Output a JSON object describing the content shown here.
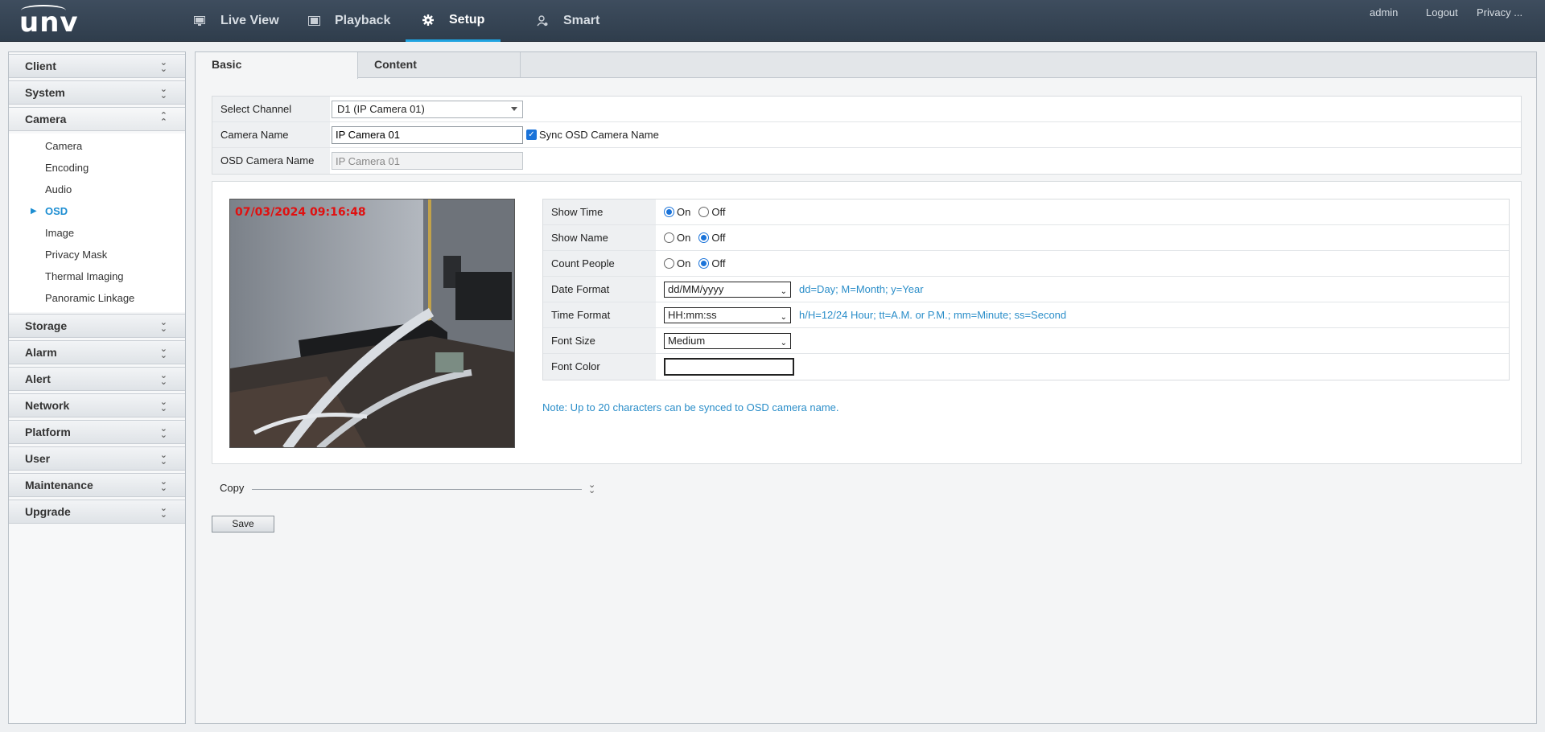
{
  "brand": {
    "logo": "unv"
  },
  "nav": {
    "items": [
      {
        "label": "Live View",
        "icon": "monitor-icon"
      },
      {
        "label": "Playback",
        "icon": "film-icon"
      },
      {
        "label": "Setup",
        "icon": "gear-icon",
        "active": true
      },
      {
        "label": "Smart",
        "icon": "smart-person-icon"
      }
    ],
    "user": "admin",
    "logout": "Logout",
    "privacy": "Privacy ..."
  },
  "sidebar": {
    "groups": [
      {
        "label": "Client"
      },
      {
        "label": "System"
      },
      {
        "label": "Camera",
        "open": true,
        "items": [
          "Camera",
          "Encoding",
          "Audio",
          "OSD",
          "Image",
          "Privacy Mask",
          "Thermal Imaging",
          "Panoramic Linkage"
        ],
        "active_item": "OSD"
      },
      {
        "label": "Storage"
      },
      {
        "label": "Alarm"
      },
      {
        "label": "Alert"
      },
      {
        "label": "Network"
      },
      {
        "label": "Platform"
      },
      {
        "label": "User"
      },
      {
        "label": "Maintenance"
      },
      {
        "label": "Upgrade"
      }
    ]
  },
  "tabs": [
    "Basic",
    "Content"
  ],
  "channel_form": {
    "select_channel_label": "Select Channel",
    "select_channel_value": "D1 (IP Camera 01)",
    "camera_name_label": "Camera Name",
    "camera_name_value": "IP Camera 01",
    "sync_label": "Sync OSD Camera Name",
    "sync_checked": true,
    "osd_camera_name_label": "OSD Camera Name",
    "osd_camera_name_value": "IP Camera 01"
  },
  "preview": {
    "overlay_date": "07/03/2024",
    "overlay_time": "09:16:48",
    "overlay_color": "#e01010"
  },
  "osd": {
    "on_label": "On",
    "off_label": "Off",
    "show_time": {
      "label": "Show Time",
      "value": "On"
    },
    "show_name": {
      "label": "Show Name",
      "value": "Off"
    },
    "count_people": {
      "label": "Count People",
      "value": "Off"
    },
    "date_format": {
      "label": "Date Format",
      "value": "dd/MM/yyyy",
      "hint": "dd=Day; M=Month; y=Year"
    },
    "time_format": {
      "label": "Time Format",
      "value": "HH:mm:ss",
      "hint": "h/H=12/24 Hour; tt=A.M. or P.M.; mm=Minute; ss=Second"
    },
    "font_size": {
      "label": "Font Size",
      "value": "Medium"
    },
    "font_color": {
      "label": "Font Color",
      "value": "#ffffff"
    }
  },
  "note": "Note: Up to 20 characters can be synced to OSD camera name.",
  "copy_label": "Copy",
  "save_label": "Save",
  "colors": {
    "accent": "#1fa3e0",
    "link": "#2b8ec9",
    "topbar": "#34414f"
  }
}
